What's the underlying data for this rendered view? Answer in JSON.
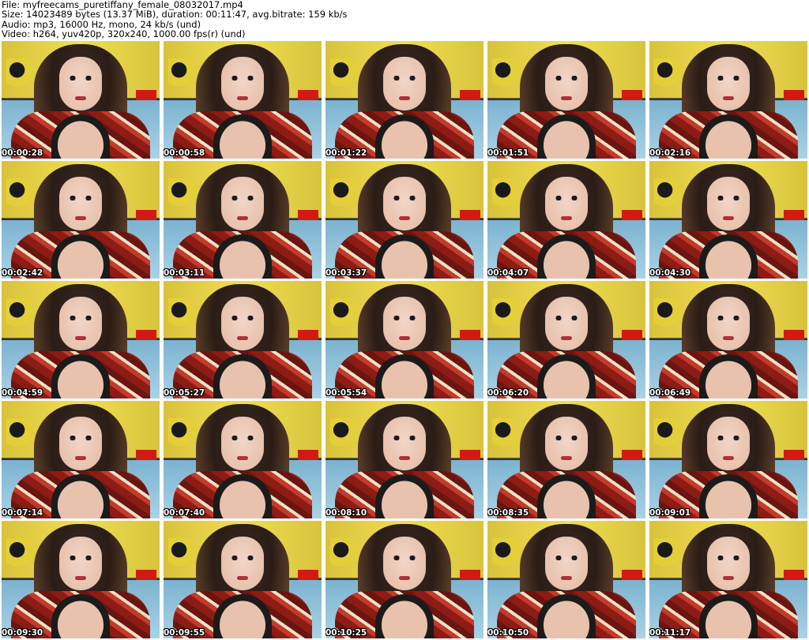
{
  "header": {
    "file": "File: myfreecams_puretiffany_female_08032017.mp4",
    "size": "Size: 14023489 bytes (13.37 MiB), duration: 00:11:47, avg.bitrate: 159 kb/s",
    "audio": "Audio: mp3, 16000 Hz, mono, 24 kb/s (und)",
    "video": "Video: h264, yuv420p, 320x240, 1000.00 fps(r) (und)"
  },
  "thumbnails": [
    {
      "timestamp": "00:00:28"
    },
    {
      "timestamp": "00:00:58"
    },
    {
      "timestamp": "00:01:22"
    },
    {
      "timestamp": "00:01:51"
    },
    {
      "timestamp": "00:02:16"
    },
    {
      "timestamp": "00:02:42"
    },
    {
      "timestamp": "00:03:11"
    },
    {
      "timestamp": "00:03:37"
    },
    {
      "timestamp": "00:04:07"
    },
    {
      "timestamp": "00:04:30"
    },
    {
      "timestamp": "00:04:59"
    },
    {
      "timestamp": "00:05:27"
    },
    {
      "timestamp": "00:05:54"
    },
    {
      "timestamp": "00:06:20"
    },
    {
      "timestamp": "00:06:49"
    },
    {
      "timestamp": "00:07:14"
    },
    {
      "timestamp": "00:07:40"
    },
    {
      "timestamp": "00:08:10"
    },
    {
      "timestamp": "00:08:35"
    },
    {
      "timestamp": "00:09:01"
    },
    {
      "timestamp": "00:09:30"
    },
    {
      "timestamp": "00:09:55"
    },
    {
      "timestamp": "00:10:25"
    },
    {
      "timestamp": "00:10:50"
    },
    {
      "timestamp": "00:11:17"
    }
  ]
}
